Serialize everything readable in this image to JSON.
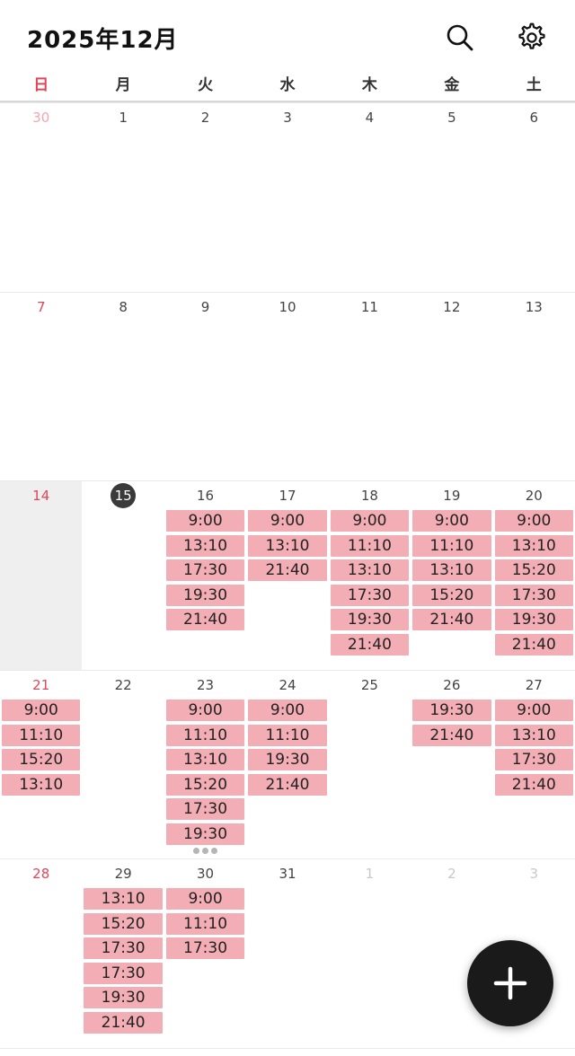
{
  "header": {
    "title": "2025年12月",
    "search_icon": "search-icon",
    "settings_icon": "gear-icon"
  },
  "weekdays": [
    "日",
    "月",
    "火",
    "水",
    "木",
    "金",
    "土"
  ],
  "colors": {
    "event_bg": "#f3adb4",
    "sunday": "#e0465a",
    "today_bg": "#3a3a3a",
    "fab_bg": "#1a1a1a"
  },
  "weeks": [
    {
      "days": [
        {
          "num": "30",
          "other": true,
          "events": []
        },
        {
          "num": "1",
          "events": []
        },
        {
          "num": "2",
          "events": []
        },
        {
          "num": "3",
          "events": []
        },
        {
          "num": "4",
          "events": []
        },
        {
          "num": "5",
          "events": []
        },
        {
          "num": "6",
          "events": []
        }
      ]
    },
    {
      "days": [
        {
          "num": "7",
          "events": []
        },
        {
          "num": "8",
          "events": []
        },
        {
          "num": "9",
          "events": []
        },
        {
          "num": "10",
          "events": []
        },
        {
          "num": "11",
          "events": []
        },
        {
          "num": "12",
          "events": []
        },
        {
          "num": "13",
          "events": []
        }
      ]
    },
    {
      "days": [
        {
          "num": "14",
          "shaded": true,
          "events": []
        },
        {
          "num": "15",
          "today": true,
          "events": []
        },
        {
          "num": "16",
          "events": [
            "9:00",
            "13:10",
            "17:30",
            "19:30",
            "21:40"
          ]
        },
        {
          "num": "17",
          "events": [
            "9:00",
            "13:10",
            "21:40"
          ]
        },
        {
          "num": "18",
          "events": [
            "9:00",
            "11:10",
            "13:10",
            "17:30",
            "19:30",
            "21:40"
          ]
        },
        {
          "num": "19",
          "events": [
            "9:00",
            "11:10",
            "13:10",
            "15:20",
            "21:40"
          ]
        },
        {
          "num": "20",
          "events": [
            "9:00",
            "13:10",
            "15:20",
            "17:30",
            "19:30",
            "21:40"
          ]
        }
      ]
    },
    {
      "days": [
        {
          "num": "21",
          "events": [
            "9:00",
            "11:10",
            "15:20",
            "13:10"
          ]
        },
        {
          "num": "22",
          "events": []
        },
        {
          "num": "23",
          "events": [
            "9:00",
            "11:10",
            "13:10",
            "15:20",
            "17:30",
            "19:30"
          ],
          "more": true
        },
        {
          "num": "24",
          "events": [
            "9:00",
            "11:10",
            "19:30",
            "21:40"
          ]
        },
        {
          "num": "25",
          "events": []
        },
        {
          "num": "26",
          "events": [
            "19:30",
            "21:40"
          ]
        },
        {
          "num": "27",
          "events": [
            "9:00",
            "13:10",
            "17:30",
            "21:40"
          ]
        }
      ]
    },
    {
      "days": [
        {
          "num": "28",
          "events": []
        },
        {
          "num": "29",
          "events": [
            "13:10",
            "15:20",
            "17:30",
            "17:30",
            "19:30",
            "21:40"
          ]
        },
        {
          "num": "30",
          "events": [
            "9:00",
            "11:10",
            "17:30"
          ]
        },
        {
          "num": "31",
          "events": []
        },
        {
          "num": "1",
          "other": true,
          "events": []
        },
        {
          "num": "2",
          "other": true,
          "events": []
        },
        {
          "num": "3",
          "other": true,
          "events": []
        }
      ]
    }
  ],
  "fab": {
    "icon": "plus-icon"
  }
}
